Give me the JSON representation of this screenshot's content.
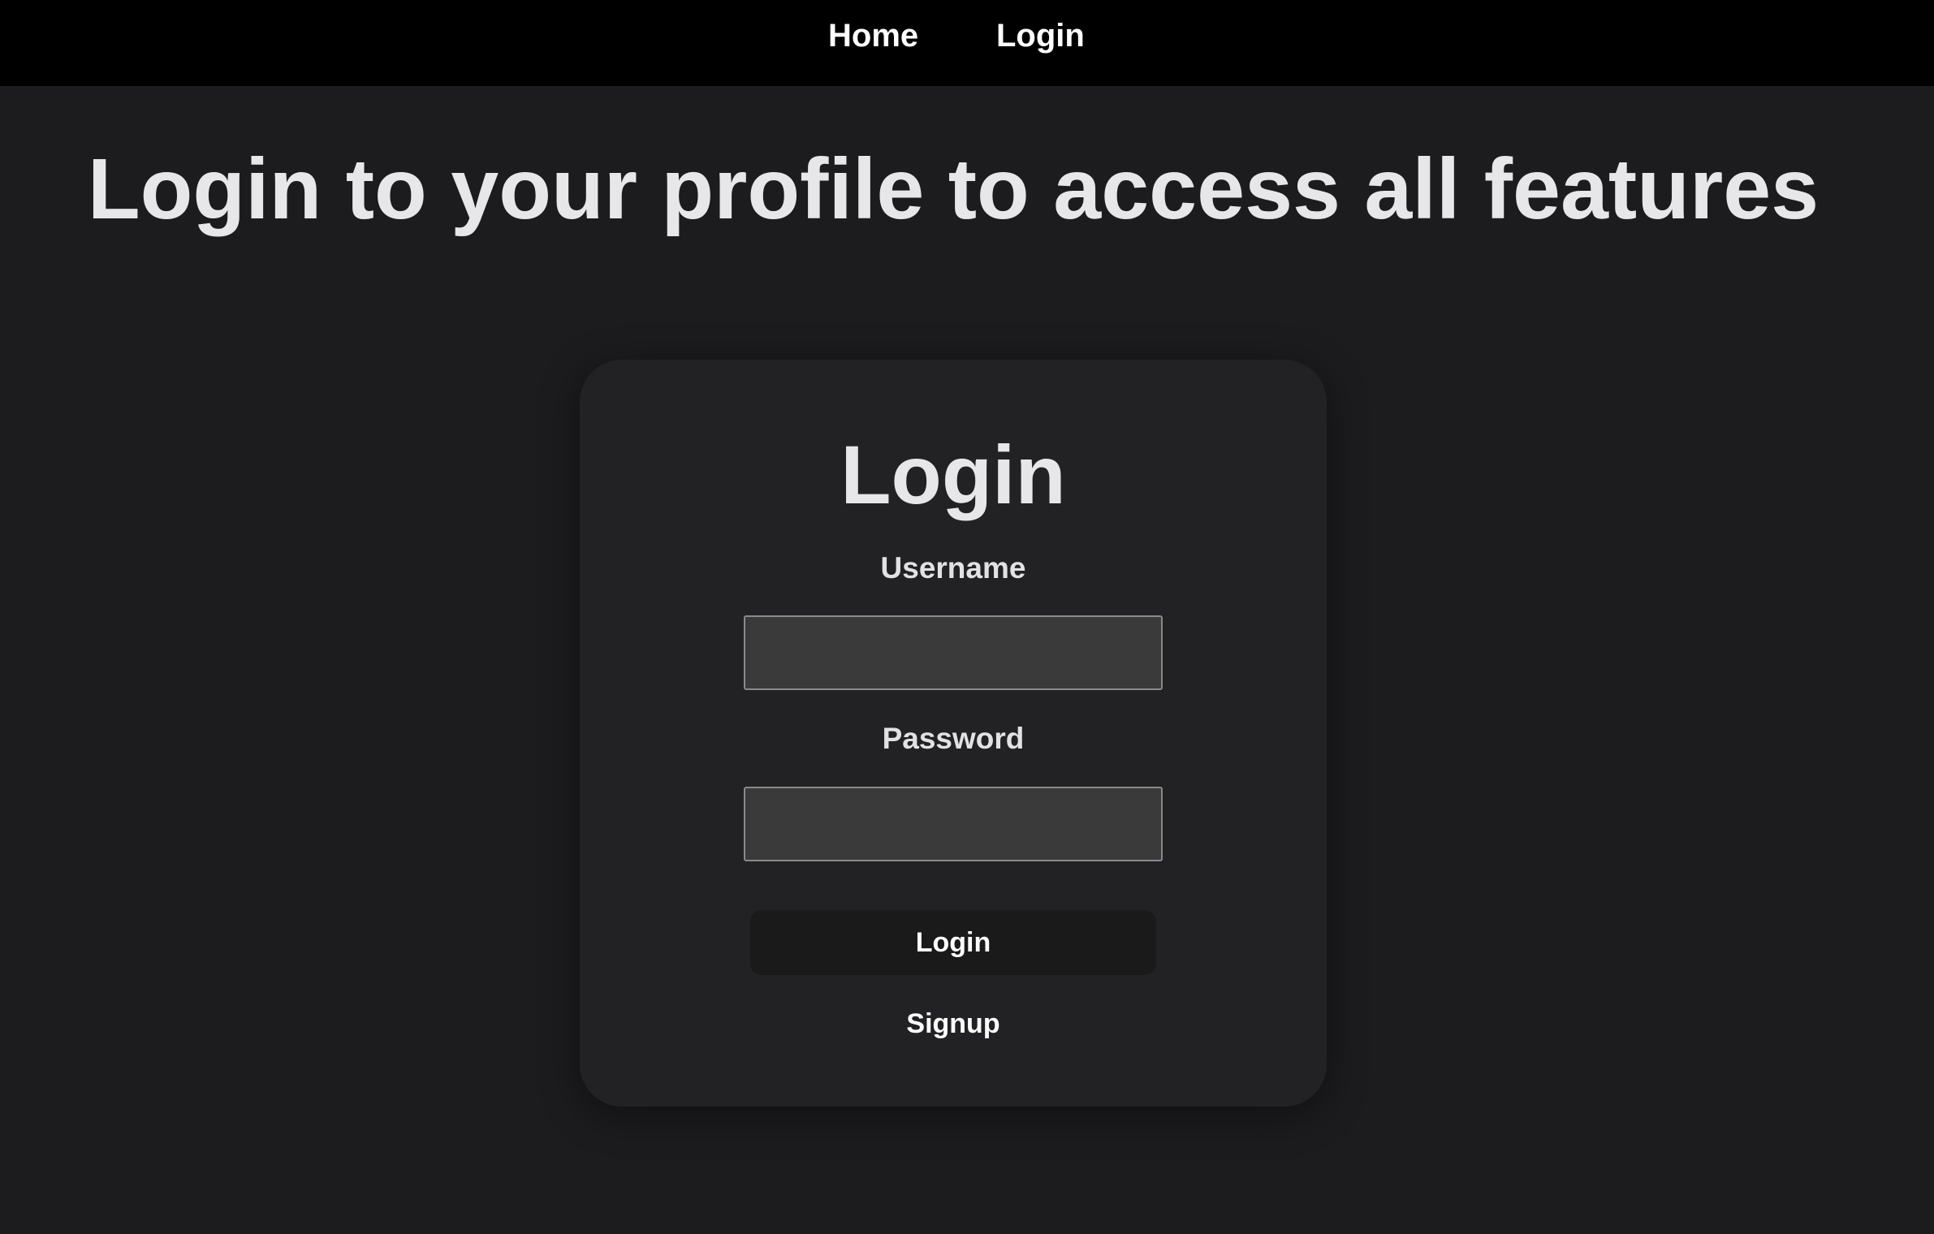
{
  "nav": {
    "items": [
      {
        "label": "Home"
      },
      {
        "label": "Login"
      }
    ]
  },
  "page": {
    "title": "Login to your profile to access all features"
  },
  "login_form": {
    "title": "Login",
    "username_label": "Username",
    "username_value": "",
    "password_label": "Password",
    "password_value": "",
    "submit_label": "Login",
    "signup_label": "Signup"
  },
  "colors": {
    "background": "#1c1c1e",
    "nav_background": "#000000",
    "card_background": "#222224",
    "input_background": "#3a3a3a",
    "button_background": "#1a1a1a",
    "text": "#e6e6e8"
  }
}
